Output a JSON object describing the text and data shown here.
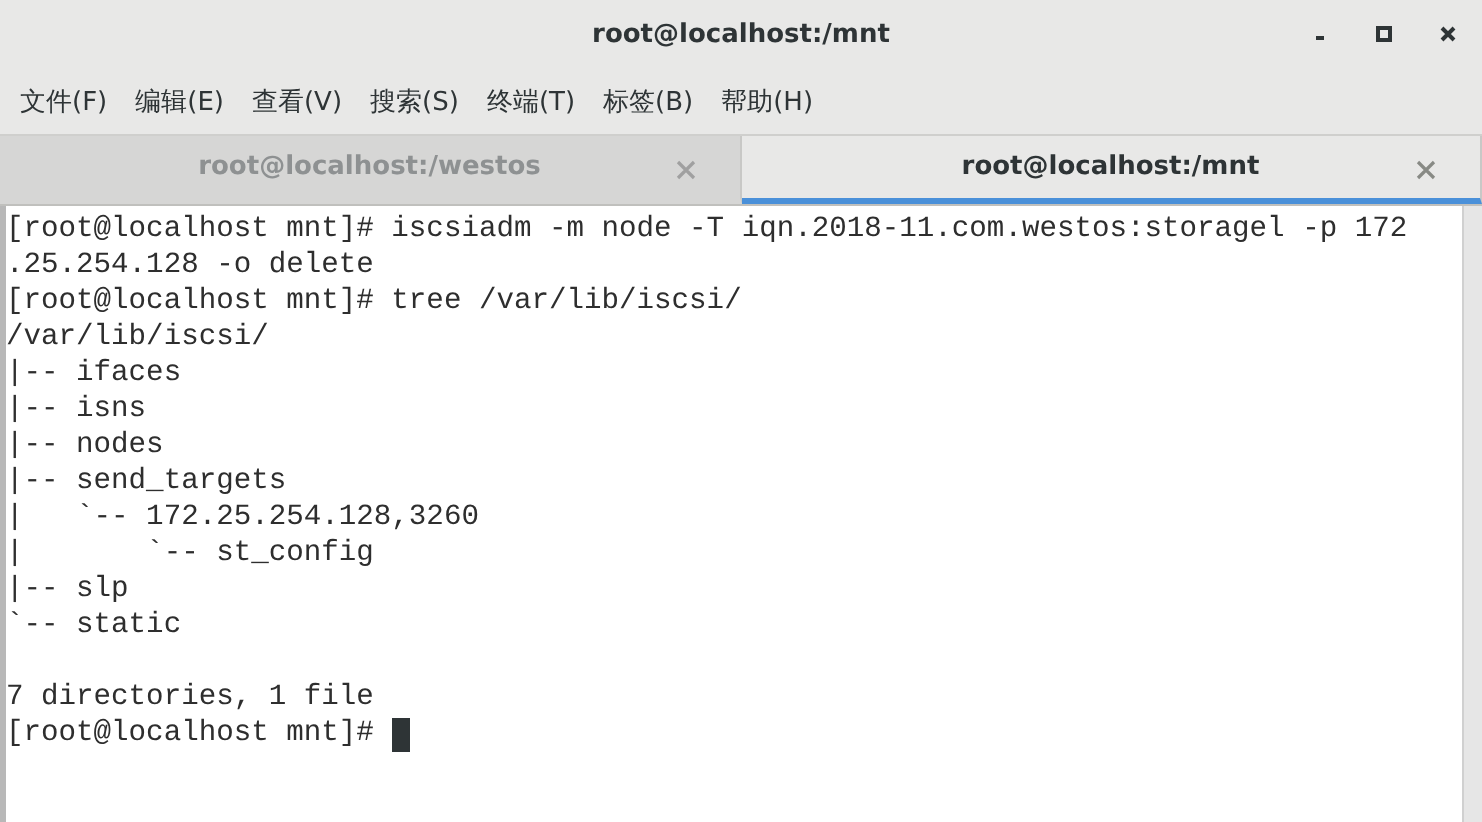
{
  "window": {
    "title": "root@localhost:/mnt"
  },
  "menu": [
    "文件(F)",
    "编辑(E)",
    "查看(V)",
    "搜索(S)",
    "终端(T)",
    "标签(B)",
    "帮助(H)"
  ],
  "tabs": [
    {
      "label": "root@localhost:/westos",
      "selected": false
    },
    {
      "label": "root@localhost:/mnt",
      "selected": true
    }
  ],
  "terminal": {
    "lines": [
      {
        "kind": "text",
        "text": "[root@localhost mnt]# iscsiadm -m node -T iqn.2018-11.com.westos:storagel -p 172"
      },
      {
        "kind": "text",
        "text": ".25.254.128 -o delete"
      },
      {
        "kind": "text",
        "text": "[root@localhost mnt]# tree /var/lib/iscsi/"
      },
      {
        "kind": "text",
        "text": "/var/lib/iscsi/"
      },
      {
        "kind": "text",
        "text": "|-- ifaces"
      },
      {
        "kind": "text",
        "text": "|-- isns"
      },
      {
        "kind": "text",
        "text": "|-- nodes"
      },
      {
        "kind": "text",
        "text": "|-- send_targets"
      },
      {
        "kind": "text",
        "text": "|   `-- 172.25.254.128,3260"
      },
      {
        "kind": "text",
        "text": "|       `-- st_config"
      },
      {
        "kind": "text",
        "text": "|-- slp"
      },
      {
        "kind": "text",
        "text": "`-- static"
      },
      {
        "kind": "blank"
      },
      {
        "kind": "text",
        "text": "7 directories, 1 file"
      },
      {
        "kind": "text",
        "text": "[root@localhost mnt]# "
      }
    ],
    "cursor": true
  }
}
